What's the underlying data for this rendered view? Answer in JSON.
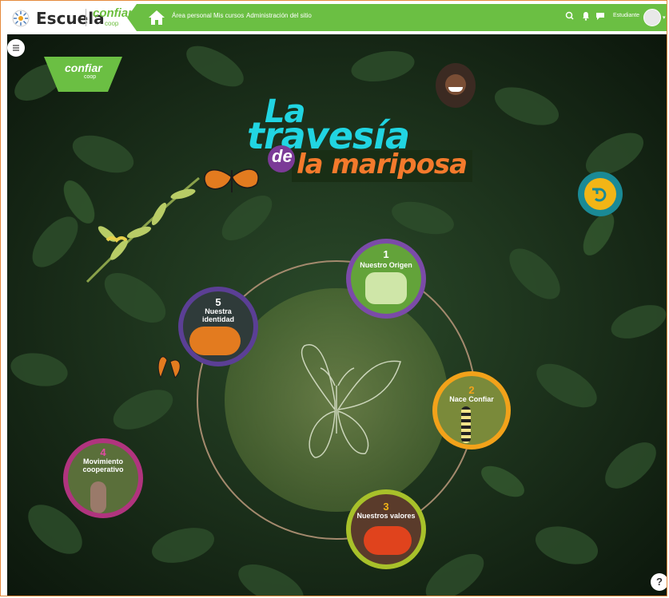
{
  "header": {
    "app_name": "Escuela",
    "brand_logo_text": "confiar",
    "brand_logo_sub": "coop",
    "nav": [
      "Área personal",
      "Mis cursos",
      "Administración del sitio"
    ],
    "user_name": "Estudiante"
  },
  "title": {
    "line1": "La",
    "line2": "travesía",
    "connector": "de",
    "line3": "la mariposa"
  },
  "side_logo": {
    "text": "confiar",
    "sub": "coop"
  },
  "stages": [
    {
      "number": "1",
      "label": "Nuestro Origen"
    },
    {
      "number": "2",
      "label": "Nace Confiar"
    },
    {
      "number": "3",
      "label": "Nuestros valores"
    },
    {
      "number": "4",
      "label": "Movimiento cooperativo"
    },
    {
      "number": "5",
      "label": "Nuestra identidad"
    }
  ],
  "help": "?",
  "colors": {
    "header_green": "#6bbf43",
    "title_cyan": "#21d5e2",
    "title_orange": "#f47a2c",
    "stage1_ring": "#7b4ba8",
    "stage2_ring": "#f2a21a",
    "stage3_ring": "#a8c12a",
    "stage4_ring": "#b0347e",
    "stage5_ring": "#5b3f95",
    "reset_ring": "#1a8a96"
  },
  "icons": [
    "home-icon",
    "search-icon",
    "bell-icon",
    "chat-icon",
    "menu-icon",
    "reset-icon",
    "help-icon"
  ]
}
